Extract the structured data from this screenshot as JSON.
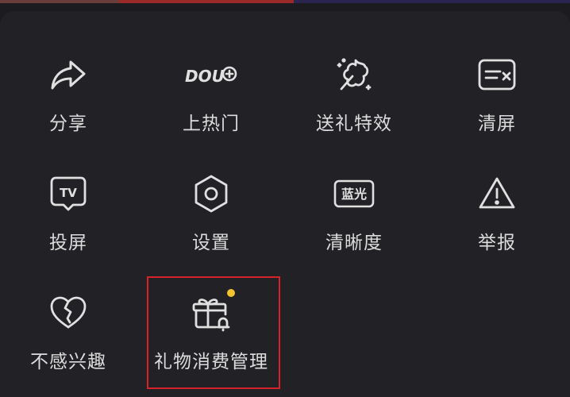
{
  "menu": {
    "items": [
      {
        "label": "分享",
        "icon": "share-icon"
      },
      {
        "label": "上热门",
        "icon": "dou-plus-icon"
      },
      {
        "label": "送礼特效",
        "icon": "gift-effect-icon"
      },
      {
        "label": "清屏",
        "icon": "clear-screen-icon"
      },
      {
        "label": "投屏",
        "icon": "tv-cast-icon"
      },
      {
        "label": "设置",
        "icon": "settings-hexagon-icon"
      },
      {
        "label": "清晰度",
        "icon": "quality-icon"
      },
      {
        "label": "举报",
        "icon": "warning-icon"
      },
      {
        "label": "不感兴趣",
        "icon": "broken-heart-icon"
      },
      {
        "label": "礼物消费管理",
        "icon": "gift-bell-icon"
      }
    ],
    "icon_text": {
      "dou": "DOU",
      "quality": "蓝光",
      "tv": "TV"
    }
  },
  "colors": {
    "background": "#222226",
    "icon_stroke": "#e0e0e0",
    "label": "#dcdcdc",
    "highlight_border": "#d6232a",
    "badge_dot": "#f4c430"
  }
}
